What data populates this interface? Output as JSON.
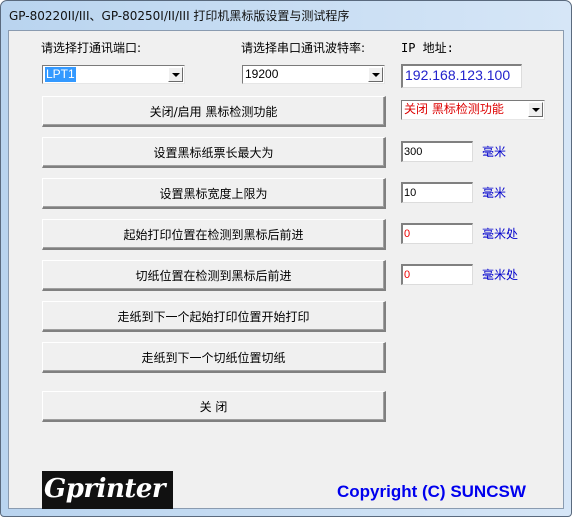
{
  "window": {
    "title": "GP-80220II/III、GP-80250I/II/III 打印机黑标版设置与测试程序"
  },
  "port": {
    "label": "请选择打通讯端口:",
    "value": "LPT1"
  },
  "baud": {
    "label": "请选择串口通讯波特率:",
    "value": "19200"
  },
  "ip": {
    "label": "IP 地址:",
    "value": "192.168.123.100",
    "color": "#2222cc"
  },
  "blackmark": {
    "toggle_button": "关闭/启用  黑标检测功能",
    "mode_value": "关闭  黑标检测功能",
    "mode_color": "#dd0000"
  },
  "settings": [
    {
      "button": "设置黑标纸票长最大为",
      "value": "300",
      "value_color": "#000000",
      "unit": "毫米"
    },
    {
      "button": "设置黑标宽度上限为",
      "value": "10",
      "value_color": "#000000",
      "unit": "毫米"
    },
    {
      "button": "起始打印位置在检测到黑标后前进",
      "value": "0",
      "value_color": "#ee0000",
      "unit": "毫米处"
    },
    {
      "button": "切纸位置在检测到黑标后前进",
      "value": "0",
      "value_color": "#ee0000",
      "unit": "毫米处"
    }
  ],
  "actions": {
    "feed_print": "走纸到下一个起始打印位置开始打印",
    "feed_cut": "走纸到下一个切纸位置切纸",
    "close": "关  闭"
  },
  "footer": {
    "logo_text": "Gprinter",
    "copyright": "Copyright (C) SUNCSW",
    "copyright_color": "#0000ee"
  }
}
